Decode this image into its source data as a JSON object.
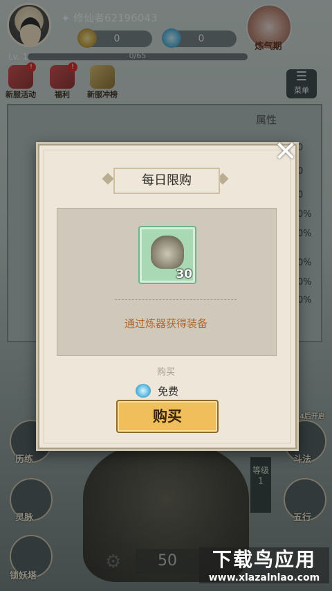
{
  "player": {
    "name": "修仙者62196043",
    "level": "Lv. 1",
    "xp": "0/65"
  },
  "currency": {
    "coins": "0",
    "gems": "0"
  },
  "top": {
    "lianqi_label": "炼气期"
  },
  "events": [
    {
      "label": "新服活动",
      "badge": "!"
    },
    {
      "label": "福利",
      "badge": "!"
    },
    {
      "label": "新服冲榜",
      "badge": ""
    }
  ],
  "menu": {
    "label": "菜单"
  },
  "background": {
    "attr_title": "属性",
    "right_values": [
      "0",
      "0",
      "0",
      "0%",
      "0%",
      "0%",
      "0%",
      "0%"
    ],
    "side_left": [
      "历练",
      "灵脉",
      "锁妖塔"
    ],
    "side_right": [
      "斗法",
      "五行"
    ],
    "level_tag": "等级 1",
    "count": "50",
    "event_timer": "14后开启"
  },
  "dialog": {
    "title": "每日限购",
    "item_count": "30",
    "description": "通过炼器获得装备",
    "buy_label_small": "购买",
    "price": "免费",
    "buy_button": "购买"
  },
  "watermark": {
    "main": "下载鸟应用",
    "sub": "www.xlazalnlao.com"
  }
}
